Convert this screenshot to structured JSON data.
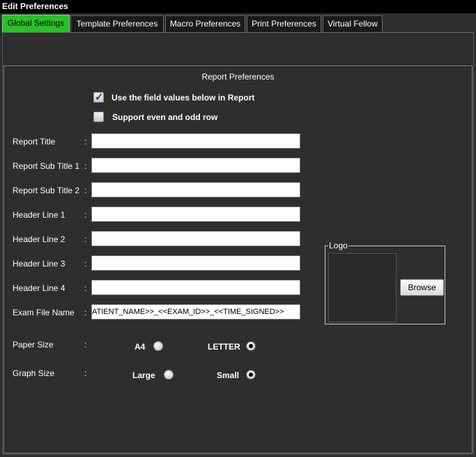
{
  "window": {
    "title": "Edit Preferences"
  },
  "tabs": [
    {
      "label": "Global Settings",
      "active": true
    },
    {
      "label": "Template Preferences",
      "active": false
    },
    {
      "label": "Macro Preferences",
      "active": false
    },
    {
      "label": "Print Preferences",
      "active": false
    },
    {
      "label": "Virtual Fellow",
      "active": false
    }
  ],
  "panel": {
    "title": "Report Preferences",
    "use_field_values": {
      "label": "Use the field values below in Report",
      "checked": true
    },
    "even_odd_row": {
      "label": "Support even and odd row",
      "checked": false
    },
    "fields": [
      {
        "label": "Report Title",
        "value": ""
      },
      {
        "label": "Report Sub Title 1",
        "value": ""
      },
      {
        "label": "Report Sub Title 2",
        "value": ""
      },
      {
        "label": "Header Line 1",
        "value": ""
      },
      {
        "label": "Header Line 2",
        "value": ""
      },
      {
        "label": "Header Line 3",
        "value": ""
      },
      {
        "label": "Header Line 4",
        "value": ""
      },
      {
        "label": "Exam File Name",
        "value": "ATIENT_NAME>>_<<EXAM_ID>>_<<TIME_SIGNED>>"
      }
    ],
    "colon": ":",
    "paper_size": {
      "label": "Paper Size",
      "options": [
        {
          "label": "A4",
          "selected": false
        },
        {
          "label": "LETTER",
          "selected": true
        }
      ]
    },
    "graph_size": {
      "label": "Graph Size",
      "options": [
        {
          "label": "Large",
          "selected": false
        },
        {
          "label": "Small",
          "selected": true
        }
      ]
    },
    "logo": {
      "legend": "Logo",
      "browse_label": "Browse"
    }
  },
  "colors": {
    "background": "#2e2e2e",
    "active_tab": "#27c227",
    "titlebar": "#000000"
  }
}
